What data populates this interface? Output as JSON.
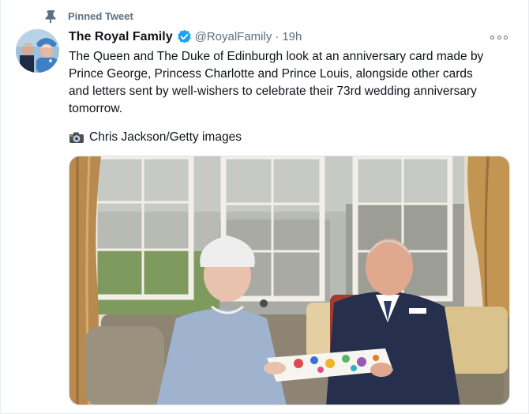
{
  "pinned": {
    "label": "Pinned Tweet",
    "icon": "pin-icon"
  },
  "author": {
    "display_name": "The Royal Family",
    "verified": true,
    "handle": "@RoyalFamily",
    "separator": "·",
    "timestamp": "19h"
  },
  "tweet": {
    "lines": [
      "The Queen and The Duke of Edinburgh look at an anniversary card made by",
      "Prince George, Princess Charlotte and Prince Louis, alongside other cards",
      "and letters sent by well-wishers to celebrate their 73rd wedding anniversary",
      "tomorrow."
    ],
    "credit_icon": "camera-icon",
    "credit": "Chris Jackson/Getty images"
  },
  "colors": {
    "text_primary": "#0f1419",
    "text_secondary": "#5b7083",
    "verified_blue": "#1da1f2",
    "border": "#e6ecf0"
  }
}
